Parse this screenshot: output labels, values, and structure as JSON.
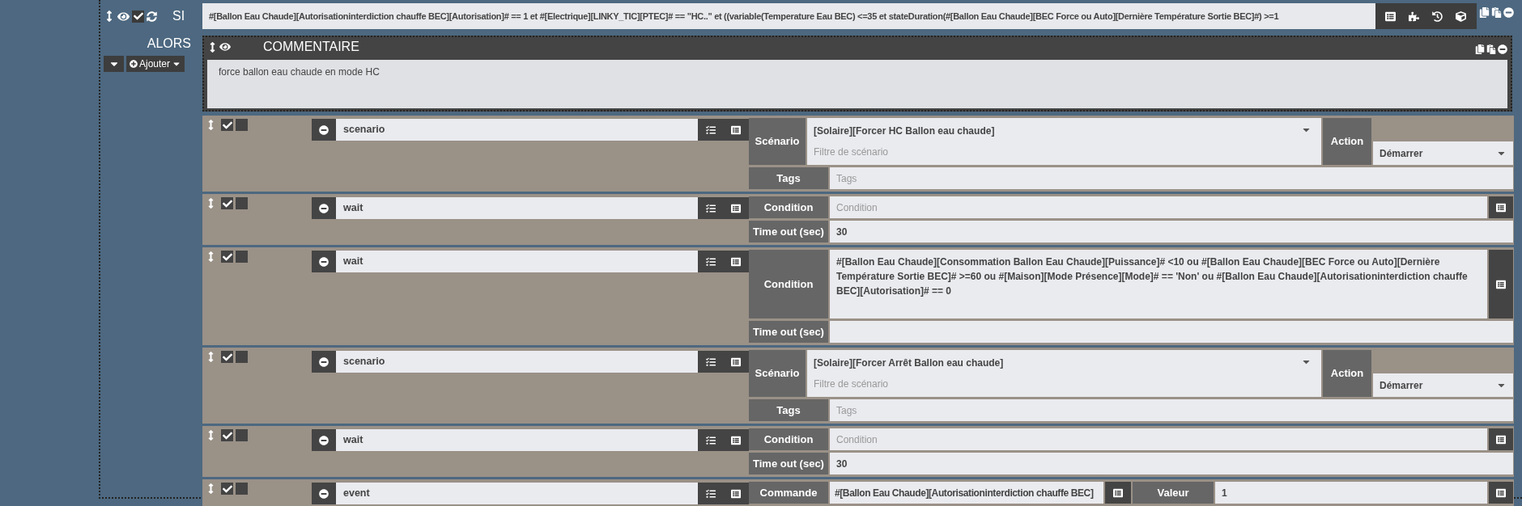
{
  "condition": {
    "label": "SI",
    "enabled": true,
    "value": "#[Ballon Eau Chaude][Autorisationinterdiction chauffe BEC][Autorisation]# == 1 et #[Electrique][LINKY_TIC][PTEC]# == \"HC..\"  et ((variable(Temperature Eau BEC) <=35 et stateDuration(#[Ballon Eau Chaude][BEC Force ou Auto][Dernière Température Sortie BEC]#) >=1"
  },
  "then_label": "ALORS",
  "add_button": "Ajouter",
  "comment": {
    "title": "COMMENTAIRE",
    "text": "force ballon eau chaude en mode HC"
  },
  "actions": [
    {
      "kind": "scenario",
      "enabled": true,
      "parallel": false,
      "name": "scenario",
      "scenario_label": "Scénario",
      "scenario_value": "[Solaire][Forcer HC Ballon eau chaude]",
      "filter_placeholder": "Filtre de scénario",
      "action_label": "Action",
      "action_value": "Démarrer",
      "tags_label": "Tags",
      "tags_placeholder": "Tags"
    },
    {
      "kind": "wait",
      "enabled": true,
      "parallel": false,
      "name": "wait",
      "condition_label": "Condition",
      "condition_placeholder": "Condition",
      "timeout_label": "Time out (sec)",
      "timeout_value": "30"
    },
    {
      "kind": "wait",
      "enabled": true,
      "parallel": false,
      "name": "wait",
      "condition_label": "Condition",
      "condition_value": "#[Ballon Eau Chaude][Consommation Ballon Eau Chaude][Puissance]# <10  ou #[Ballon Eau Chaude][BEC Force ou Auto][Dernière Température Sortie BEC]# >=60  ou #[Maison][Mode Présence][Mode]# == 'Non'  ou #[Ballon Eau Chaude][Autorisationinterdiction chauffe BEC][Autorisation]# == 0",
      "timeout_label": "Time out (sec)"
    },
    {
      "kind": "scenario",
      "enabled": true,
      "parallel": false,
      "name": "scenario",
      "scenario_label": "Scénario",
      "scenario_value": "[Solaire][Forcer Arrêt Ballon eau chaude]",
      "filter_placeholder": "Filtre de scénario",
      "action_label": "Action",
      "action_value": "Démarrer",
      "tags_label": "Tags",
      "tags_placeholder": "Tags"
    },
    {
      "kind": "wait",
      "enabled": true,
      "parallel": false,
      "name": "wait",
      "condition_label": "Condition",
      "condition_placeholder": "Condition",
      "timeout_label": "Time out (sec)",
      "timeout_value": "30"
    },
    {
      "kind": "event",
      "enabled": true,
      "parallel": false,
      "name": "event",
      "command_label": "Commande",
      "command_value": "#[Ballon Eau Chaude][Autorisationinterdiction chauffe BEC]",
      "value_label": "Valeur",
      "value_value": "1"
    }
  ]
}
